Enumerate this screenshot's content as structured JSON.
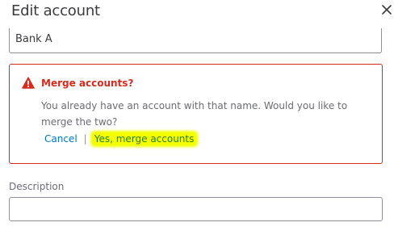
{
  "dialog": {
    "title": "Edit account",
    "close_icon": "close-icon"
  },
  "account_name": {
    "value": "Bank A"
  },
  "merge_alert": {
    "icon": "warning-icon",
    "title": "Merge accounts?",
    "message": "You already have an account with that name. Would you like to merge the two?",
    "cancel_label": "Cancel",
    "separator": "|",
    "confirm_label": "Yes, merge accounts"
  },
  "description": {
    "label": "Description",
    "value": ""
  },
  "colors": {
    "error": "#d52b1e",
    "link": "#0077c5",
    "highlight": "#f3ff00"
  }
}
